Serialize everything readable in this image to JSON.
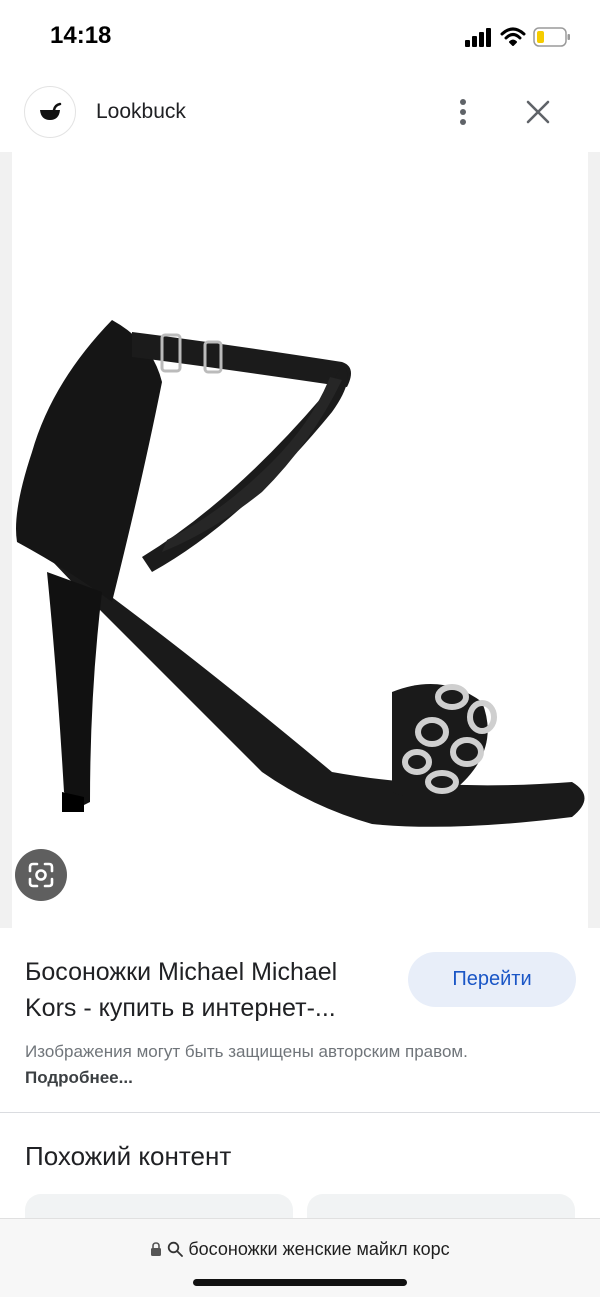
{
  "status_bar": {
    "time": "14:18"
  },
  "header": {
    "site_name": "Lookbuck",
    "logo_icon": "bowl-logo-icon",
    "more_icon": "more-vertical-icon",
    "close_icon": "close-icon"
  },
  "image": {
    "description_icon": "lens-icon"
  },
  "result": {
    "title_line1": "Босоножки Michael Michael",
    "title_line2": "Kors - купить в интернет-...",
    "go_button_label": "Перейти",
    "copyright_text": "Изображения могут быть защищены авторским правом.",
    "more_link": "Подробнее..."
  },
  "similar": {
    "heading": "Похожий контент"
  },
  "url_bar": {
    "query": "босоножки женские майкл корс"
  },
  "colors": {
    "accent": "#1a56c6",
    "button_bg": "#e8eef9"
  }
}
